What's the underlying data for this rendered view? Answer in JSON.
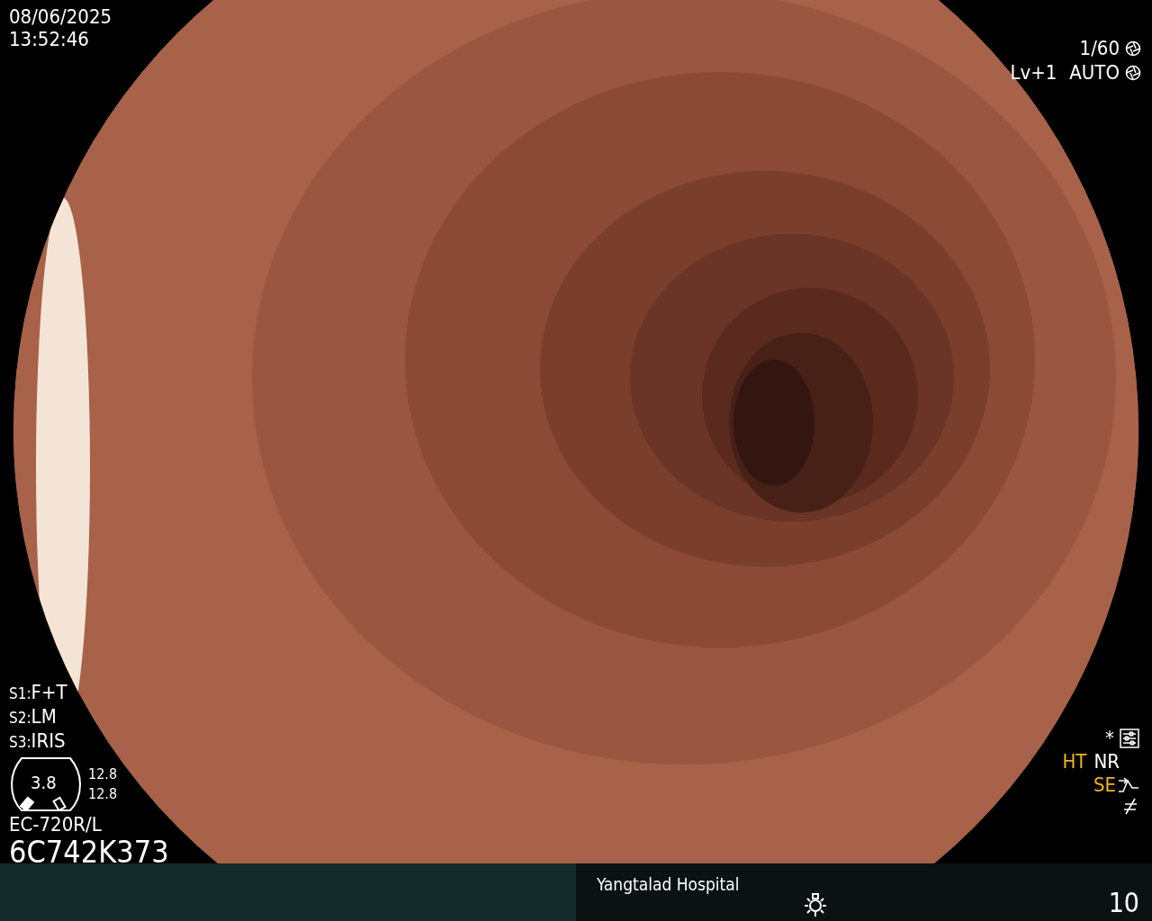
{
  "datetime": {
    "date": "08/06/2025",
    "time": "13:52:46"
  },
  "exposure": {
    "shutter": "1/60",
    "level": "Lv+1",
    "mode": "AUTO"
  },
  "switches": [
    {
      "label": "S1:",
      "value": "F+T"
    },
    {
      "label": "S2:",
      "value": "LM"
    },
    {
      "label": "S3:",
      "value": "IRIS"
    }
  ],
  "gauge": {
    "value": "3.8",
    "readings": [
      "12.8",
      "12.8"
    ]
  },
  "scope": {
    "model": "EC-720R/L",
    "serial": "6C742K373"
  },
  "indicator_mark": "*",
  "indicators": [
    {
      "label": "HT",
      "on": true
    },
    {
      "label": "NR",
      "on": false
    },
    {
      "label": "SE",
      "on": true
    }
  ],
  "footer": {
    "hospital": "Yangtalad Hospital",
    "counter": "10"
  }
}
